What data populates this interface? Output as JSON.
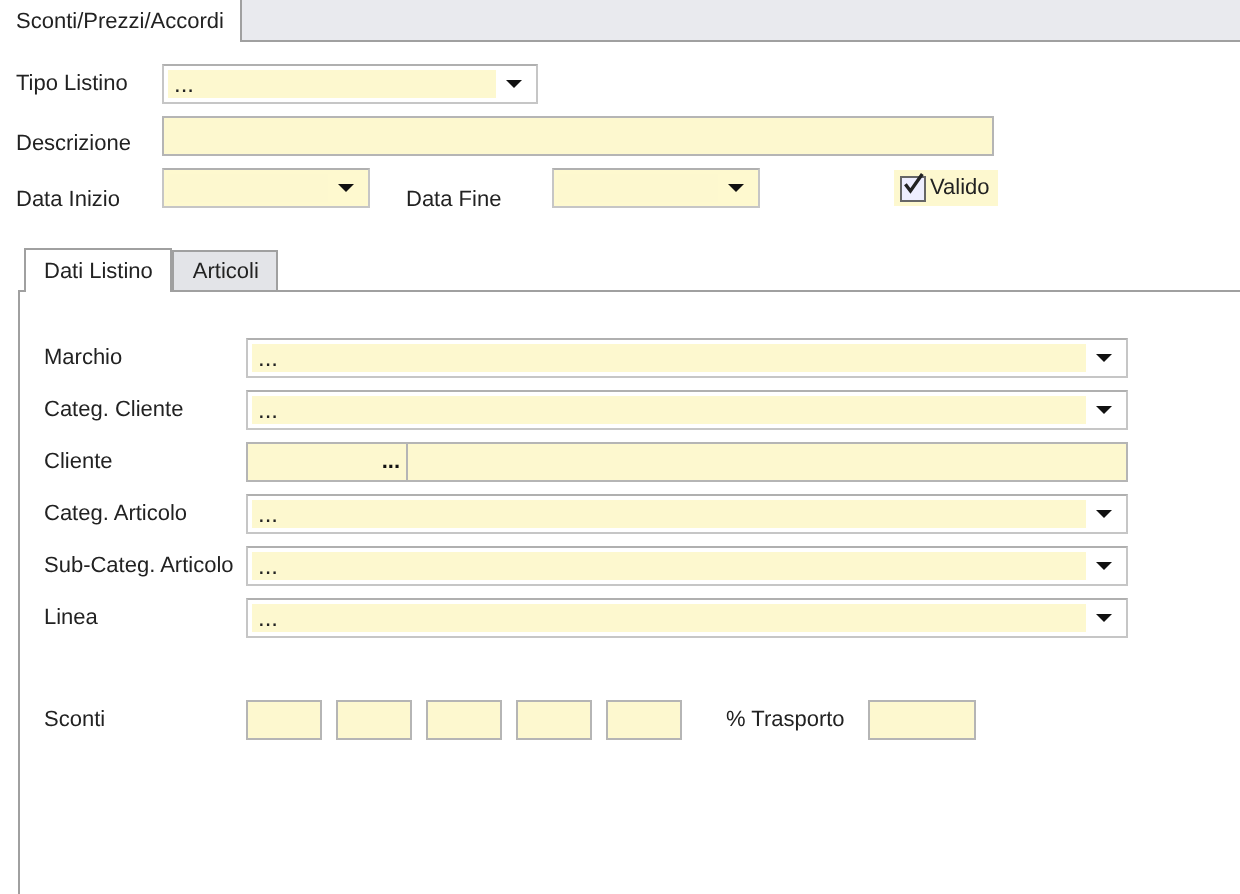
{
  "document_tab": {
    "label": "Sconti/Prezzi/Accordi",
    "selected": true
  },
  "tipo_listino": {
    "label": "Tipo Listino",
    "value": "..."
  },
  "descrizione": {
    "label": "Descrizione"
  },
  "data_inizio": {
    "label": "Data Inizio"
  },
  "data_fine": {
    "label": "Data Fine"
  },
  "valido": {
    "label": "Valido",
    "checked": true
  },
  "tabs": [
    {
      "label": "Dati Listino",
      "selected": true
    },
    {
      "label": "Articoli",
      "selected": false
    }
  ],
  "fields": [
    {
      "kind": "combo",
      "label": "Marchio",
      "value": "..."
    },
    {
      "kind": "combo",
      "label": "Categ. Cliente",
      "value": "..."
    },
    {
      "kind": "lookup",
      "label": "Cliente",
      "button": "..."
    },
    {
      "kind": "combo",
      "label": "Categ. Articolo",
      "value": "..."
    },
    {
      "kind": "combo",
      "label": "Sub-Categ. Articolo",
      "value": "..."
    },
    {
      "kind": "combo",
      "label": "Linea",
      "value": "..."
    }
  ],
  "sconti": {
    "label": "Sconti",
    "fields": [
      {
        "kind": "discount"
      },
      {
        "kind": "discount"
      },
      {
        "kind": "discount"
      },
      {
        "kind": "discount"
      },
      {
        "kind": "discount"
      }
    ]
  },
  "trasporto": {
    "label": "% Trasporto"
  }
}
